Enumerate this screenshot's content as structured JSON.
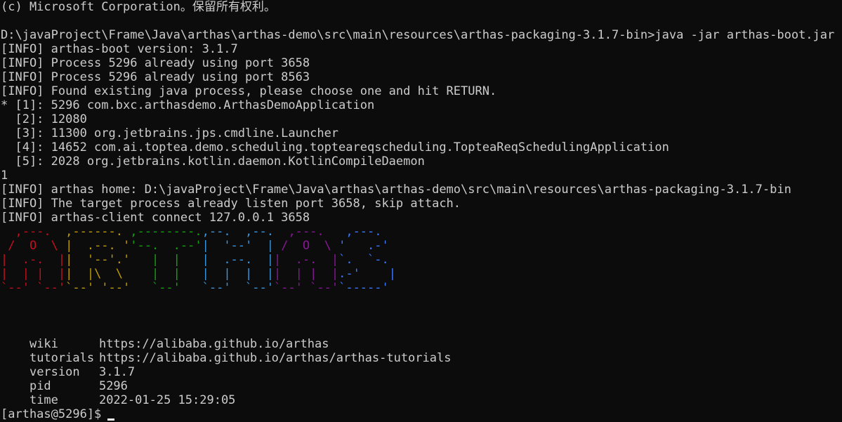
{
  "terminal": {
    "lines": [
      "(c) Microsoft Corporation。保留所有权利。",
      "",
      "D:\\javaProject\\Frame\\Java\\arthas\\arthas-demo\\src\\main\\resources\\arthas-packaging-3.1.7-bin>java -jar arthas-boot.jar",
      "[INFO] arthas-boot version: 3.1.7",
      "[INFO] Process 5296 already using port 3658",
      "[INFO] Process 5296 already using port 8563",
      "[INFO] Found existing java process, please choose one and hit RETURN.",
      "* [1]: 5296 com.bxc.arthasdemo.ArthasDemoApplication",
      "  [2]: 12080",
      "  [3]: 11300 org.jetbrains.jps.cmdline.Launcher",
      "  [4]: 14652 com.ai.toptea.demo.scheduling.topteareqscheduling.TopteaReqSchedulingApplication",
      "  [5]: 2028 org.jetbrains.kotlin.daemon.KotlinCompileDaemon",
      "1",
      "[INFO] arthas home: D:\\javaProject\\Frame\\Java\\arthas\\arthas-demo\\src\\main\\resources\\arthas-packaging-3.1.7-bin",
      "[INFO] The target process already listen port 3658, skip attach.",
      "[INFO] arthas-client connect 127.0.0.1 3658"
    ],
    "banner": {
      "colors": [
        "#c50f1f",
        "#c19c00",
        "#13a10e",
        "#3a96dd",
        "#881798",
        "#3b78ff",
        "#b4009e",
        "#61d6d6",
        "#16c60c"
      ],
      "letters": [
        {
          "char": "A",
          "color": "#c50f1f",
          "rows": [
            "  ,---.  ",
            " /  O  \\ ",
            "|  .-.  |",
            "|  | |  |",
            "`--' `--'"
          ]
        },
        {
          "char": "R",
          "color": "#c19c00",
          "rows": [
            ",------. ",
            "|  .--. '",
            "|  '--'.'",
            "|  |\\  \\ ",
            "`--' '--'"
          ]
        },
        {
          "char": "T",
          "color": "#13a10e",
          "rows": [
            ",--------.",
            "'--.  .--'",
            "   |  |   ",
            "   |  |   ",
            "   `--'   "
          ]
        },
        {
          "char": "H",
          "color": "#3a96dd",
          "rows": [
            ",--.  ,--.",
            "|  '--'  |",
            "|  .--.  |",
            "|  |  |  |",
            "`--'  `--'"
          ]
        },
        {
          "char": "A",
          "color": "#881798",
          "rows": [
            "  ,---.  ",
            " /  O  \\ ",
            "|  .-.  |",
            "|  | |  |",
            "`--' `--'"
          ]
        },
        {
          "char": "S",
          "color": "#3b78ff",
          "rows": [
            " ,---.  ",
            "'   .-' ",
            "`.  `-. ",
            ".-'    |",
            "`-----' "
          ]
        }
      ]
    },
    "info": [
      {
        "key": "wiki",
        "value": "https://alibaba.github.io/arthas"
      },
      {
        "key": "tutorials",
        "value": "https://alibaba.github.io/arthas/arthas-tutorials"
      },
      {
        "key": "version",
        "value": "3.1.7"
      },
      {
        "key": "pid",
        "value": "5296"
      },
      {
        "key": "time",
        "value": "2022-01-25 15:29:05"
      }
    ],
    "prompt": "[arthas@5296]$"
  }
}
